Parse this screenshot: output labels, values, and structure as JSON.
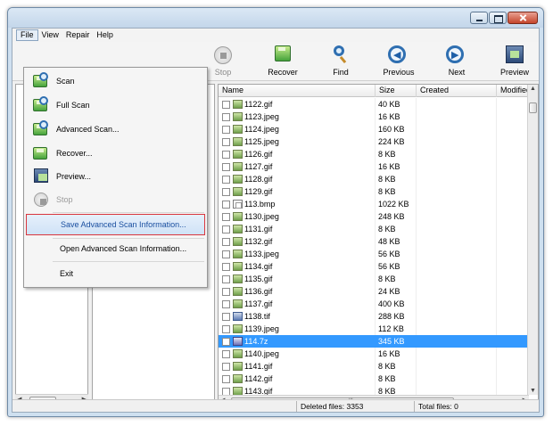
{
  "menubar": {
    "items": [
      "File",
      "View",
      "Repair",
      "Help"
    ]
  },
  "toolbar": {
    "stop": "Stop",
    "recover": "Recover",
    "find": "Find",
    "previous": "Previous",
    "next": "Next",
    "preview": "Preview"
  },
  "file_menu": {
    "scan": "Scan",
    "full_scan": "Full Scan",
    "advanced_scan": "Advanced Scan...",
    "recover": "Recover...",
    "preview": "Preview...",
    "stop": "Stop",
    "save_adv": "Save Advanced Scan Information...",
    "open_adv": "Open Advanced Scan Information...",
    "exit": "Exit"
  },
  "grid": {
    "columns": [
      "Name",
      "Size",
      "Created",
      "Modified"
    ],
    "rows": [
      {
        "name": "1122.gif",
        "size": "40 KB",
        "type": "gif"
      },
      {
        "name": "1123.jpeg",
        "size": "16 KB",
        "type": "gif"
      },
      {
        "name": "1124.jpeg",
        "size": "160 KB",
        "type": "gif"
      },
      {
        "name": "1125.jpeg",
        "size": "224 KB",
        "type": "gif"
      },
      {
        "name": "1126.gif",
        "size": "8 KB",
        "type": "gif"
      },
      {
        "name": "1127.gif",
        "size": "16 KB",
        "type": "gif"
      },
      {
        "name": "1128.gif",
        "size": "8 KB",
        "type": "gif"
      },
      {
        "name": "1129.gif",
        "size": "8 KB",
        "type": "gif"
      },
      {
        "name": "113.bmp",
        "size": "1022 KB",
        "type": "bmp"
      },
      {
        "name": "1130.jpeg",
        "size": "248 KB",
        "type": "gif"
      },
      {
        "name": "1131.gif",
        "size": "8 KB",
        "type": "gif"
      },
      {
        "name": "1132.gif",
        "size": "48 KB",
        "type": "gif"
      },
      {
        "name": "1133.jpeg",
        "size": "56 KB",
        "type": "gif"
      },
      {
        "name": "1134.gif",
        "size": "56 KB",
        "type": "gif"
      },
      {
        "name": "1135.gif",
        "size": "8 KB",
        "type": "gif"
      },
      {
        "name": "1136.gif",
        "size": "24 KB",
        "type": "gif"
      },
      {
        "name": "1137.gif",
        "size": "400 KB",
        "type": "gif"
      },
      {
        "name": "1138.tif",
        "size": "288 KB",
        "type": "tif"
      },
      {
        "name": "1139.jpeg",
        "size": "112 KB",
        "type": "gif"
      },
      {
        "name": "114.7z",
        "size": "345 KB",
        "type": "z",
        "selected": true
      },
      {
        "name": "1140.jpeg",
        "size": "16 KB",
        "type": "gif"
      },
      {
        "name": "1141.gif",
        "size": "8 KB",
        "type": "gif"
      },
      {
        "name": "1142.gif",
        "size": "8 KB",
        "type": "gif"
      },
      {
        "name": "1143.gif",
        "size": "8 KB",
        "type": "gif"
      }
    ]
  },
  "statusbar": {
    "deleted": "Deleted files: 3353",
    "total": "Total files: 0"
  },
  "colors": {
    "selection": "#3399ff",
    "highlight_border": "#d9363e"
  }
}
